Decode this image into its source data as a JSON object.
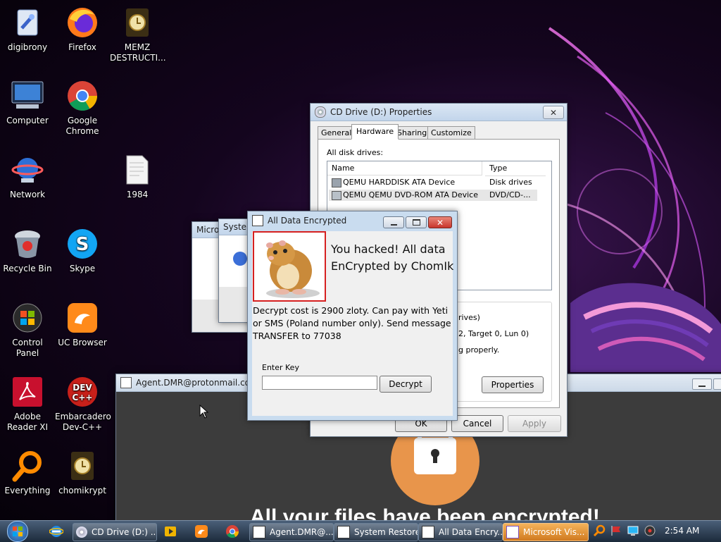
{
  "desktop": {
    "icons": [
      {
        "label": "digibrony"
      },
      {
        "label": "Firefox"
      },
      {
        "label": "MEMZ DESTRUCTI..."
      },
      {
        "label": "Computer"
      },
      {
        "label": "Google Chrome"
      },
      {
        "label": "Network"
      },
      {
        "label": "1984"
      },
      {
        "label": "Recycle Bin"
      },
      {
        "label": "Skype"
      },
      {
        "label": "Control Panel"
      },
      {
        "label": "UC Browser"
      },
      {
        "label": "Adobe Reader XI"
      },
      {
        "label": "Embarcadero Dev-C++"
      },
      {
        "label": "Everything"
      },
      {
        "label": "chomikrypt"
      }
    ]
  },
  "cd_properties": {
    "title": "CD Drive (D:) Properties",
    "tabs": [
      "General",
      "Hardware",
      "Sharing",
      "Customize"
    ],
    "active_tab": "Hardware",
    "all_disk_drives_label": "All disk drives:",
    "columns": [
      "Name",
      "Type"
    ],
    "rows": [
      {
        "name": "QEMU HARDDISK ATA Device",
        "type": "Disk drives"
      },
      {
        "name": "QEMU QEMU DVD-ROM ATA Device",
        "type": "DVD/CD-..."
      }
    ],
    "props_partial": [
      "rives)",
      "2, Target 0, Lun 0)",
      "g properly."
    ],
    "properties_button": "Properties",
    "ok": "OK",
    "cancel": "Cancel",
    "apply": "Apply"
  },
  "behind_windows": {
    "micro_title": "Micro",
    "system_title": "Systen"
  },
  "ransom": {
    "title": "All Data Encrypted",
    "headline": "You hacked! All data EnCrypted by ChomIk",
    "message": "Decrypt cost is 2900 zloty. Can pay with Yeti or SMS (Poland number only). Send message TRANSFER to 77038",
    "enter_key_label": "Enter Key",
    "key_value": "",
    "decrypt_button": "Decrypt"
  },
  "agent_window": {
    "title": "Agent.DMR@protonmail.com",
    "banner": "All your files have been encrypted!"
  },
  "taskbar": {
    "tasks": [
      {
        "label": "CD Drive (D:) ..."
      },
      {
        "label": "Agent.DMR@..."
      },
      {
        "label": "System Restore"
      },
      {
        "label": "All Data Encry..."
      },
      {
        "label": "Microsoft Vis..."
      }
    ],
    "clock": "2:54 AM"
  },
  "colors": {
    "accent_taskbar_active": "#d07a20",
    "title_bar": "#c2d5eb",
    "ransom_close": "#c8352c"
  }
}
